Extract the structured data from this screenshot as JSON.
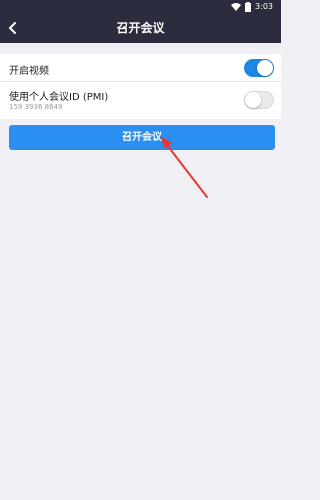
{
  "status_bar": {
    "time": "3:03"
  },
  "header": {
    "title": "召开会议"
  },
  "settings": {
    "video": {
      "label": "开启视频",
      "enabled": true
    },
    "pmi": {
      "label": "使用个人会议ID (PMI)",
      "id": "159 3936 8649",
      "enabled": false
    }
  },
  "start_button": {
    "label": "召开会议"
  },
  "colors": {
    "header": "#2b2c3d",
    "accent": "#2a8ff0",
    "arrow": "#e53935"
  }
}
